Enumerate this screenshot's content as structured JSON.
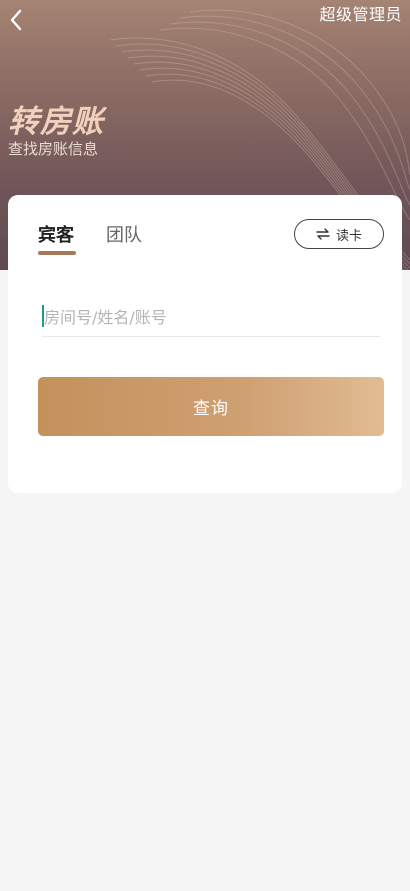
{
  "header": {
    "admin_label": "超级管理员",
    "title": "转房账",
    "subtitle": "查找房账信息"
  },
  "tabs": [
    {
      "label": "宾客",
      "active": true
    },
    {
      "label": "团队",
      "active": false
    }
  ],
  "read_card": {
    "label": "读卡",
    "icon": "swap-arrows-icon"
  },
  "search": {
    "placeholder": "房间号/姓名/账号",
    "value": ""
  },
  "query_button": {
    "label": "查询"
  },
  "colors": {
    "accent": "#a8765a",
    "button_start": "#c4915c",
    "button_end": "#e1bc93",
    "title": "#f1d1bd",
    "cursor": "#1a9e8a"
  }
}
